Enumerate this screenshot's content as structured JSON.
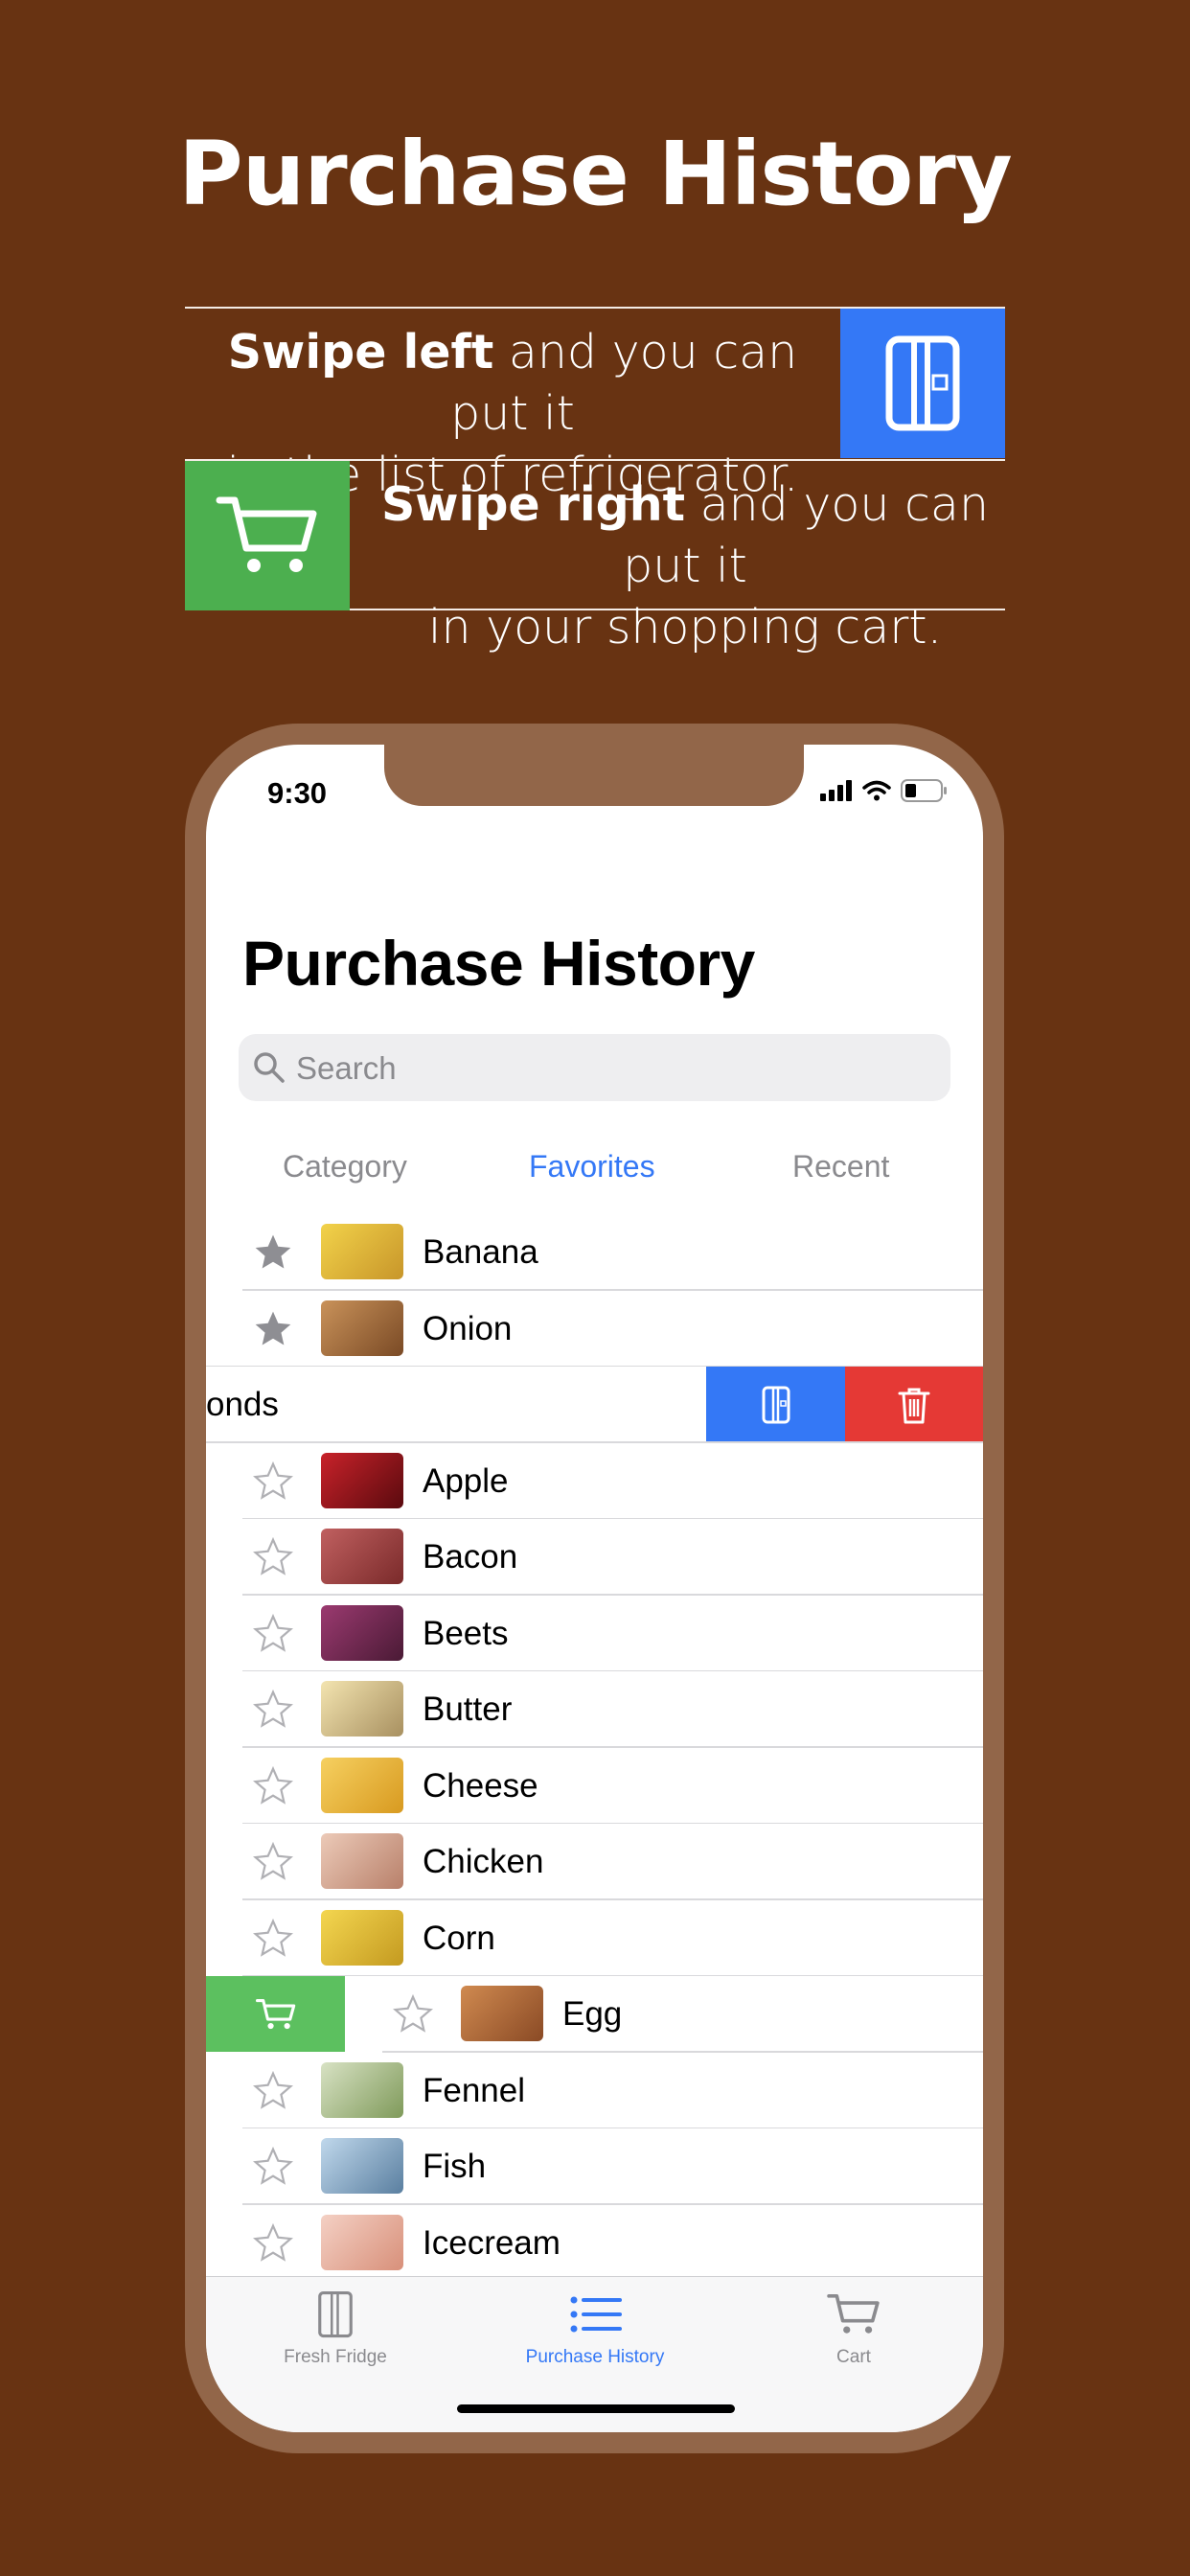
{
  "headline": "Purchase History",
  "hints": {
    "left_bold": "Swipe left",
    "left_rest_1": " and you can put it",
    "left_rest_2": "in the list of refrigerator.",
    "right_bold": "Swipe right",
    "right_rest_1": " and you can put it",
    "right_rest_2": "in your shopping cart."
  },
  "colors": {
    "background": "#683312",
    "blue": "#3478f6",
    "green": "#4caf4f",
    "red": "#e53935",
    "phone_frame": "#926649"
  },
  "status_bar": {
    "time": "9:30"
  },
  "screen": {
    "title": "Purchase History",
    "search_placeholder": "Search",
    "segments": [
      "Category",
      "Favorites",
      "Recent"
    ],
    "active_segment": "Favorites"
  },
  "items": [
    {
      "label": "Banana",
      "favorite": true,
      "thumb": "#e8c13a"
    },
    {
      "label": "Onion",
      "favorite": true,
      "thumb": "#a36a3d"
    },
    {
      "label": "onds",
      "swiped": "left"
    },
    {
      "label": "Apple",
      "favorite": false,
      "thumb": "#a0161b"
    },
    {
      "label": "Bacon",
      "favorite": false,
      "thumb": "#9b3b3b"
    },
    {
      "label": "Beets",
      "favorite": false,
      "thumb": "#7d2d5c"
    },
    {
      "label": "Butter",
      "favorite": false,
      "thumb": "#e8d49a"
    },
    {
      "label": "Cheese",
      "favorite": false,
      "thumb": "#e8b53a"
    },
    {
      "label": "Chicken",
      "favorite": false,
      "thumb": "#d9a88f"
    },
    {
      "label": "Corn",
      "favorite": false,
      "thumb": "#e6c23a"
    },
    {
      "label": "Egg",
      "favorite": false,
      "thumb": "#b86a3a",
      "swiped": "right"
    },
    {
      "label": "Fennel",
      "favorite": false,
      "thumb": "#b8c9a0"
    },
    {
      "label": "Fish",
      "favorite": false,
      "thumb": "#8faecc"
    },
    {
      "label": "Icecream",
      "favorite": false,
      "thumb": "#e7b8a7"
    }
  ],
  "tab_bar": {
    "tabs": [
      "Fresh Fridge",
      "Purchase History",
      "Cart"
    ],
    "active": "Purchase History"
  },
  "icons": [
    "fridge-icon",
    "cart-icon",
    "trash-icon",
    "star-icon",
    "search-icon",
    "list-icon",
    "signal-icon",
    "wifi-icon",
    "battery-icon"
  ]
}
